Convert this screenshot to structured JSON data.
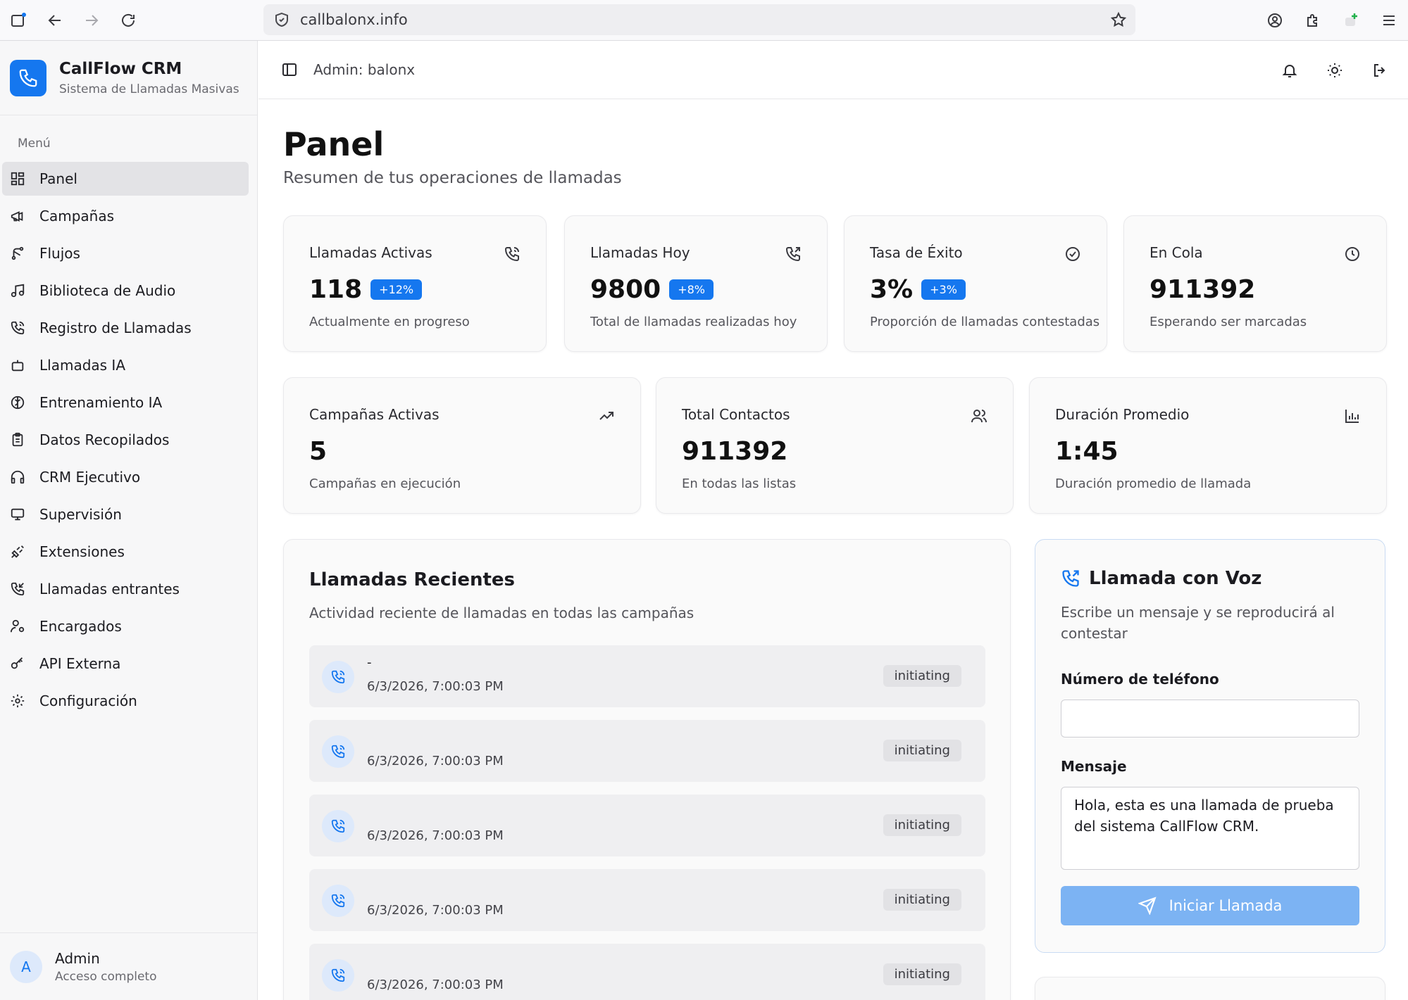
{
  "browser": {
    "url": "callbalonx.info"
  },
  "brand": {
    "title": "CallFlow CRM",
    "subtitle": "Sistema de Llamadas Masivas",
    "accent_color": "#1577ef"
  },
  "sidebar": {
    "menu_label": "Menú",
    "items": [
      {
        "label": "Panel",
        "icon": "grid-icon",
        "active": true
      },
      {
        "label": "Campañas",
        "icon": "megaphone-icon"
      },
      {
        "label": "Flujos",
        "icon": "workflow-icon"
      },
      {
        "label": "Biblioteca de Audio",
        "icon": "music-icon"
      },
      {
        "label": "Registro de Llamadas",
        "icon": "phone-icon"
      },
      {
        "label": "Llamadas IA",
        "icon": "bot-icon"
      },
      {
        "label": "Entrenamiento IA",
        "icon": "brain-icon"
      },
      {
        "label": "Datos Recopilados",
        "icon": "clipboard-icon"
      },
      {
        "label": "CRM Ejecutivo",
        "icon": "headphones-icon"
      },
      {
        "label": "Supervisión",
        "icon": "monitor-icon"
      },
      {
        "label": "Extensiones",
        "icon": "plug-icon"
      },
      {
        "label": "Llamadas entrantes",
        "icon": "phone-incoming-icon"
      },
      {
        "label": "Encargados",
        "icon": "user-cog-icon"
      },
      {
        "label": "API Externa",
        "icon": "key-icon"
      },
      {
        "label": "Configuración",
        "icon": "settings-icon"
      }
    ],
    "user": {
      "initial": "A",
      "name": "Admin",
      "role": "Acceso completo"
    }
  },
  "header": {
    "admin_label": "Admin: balonx"
  },
  "page": {
    "title": "Panel",
    "subtitle": "Resumen de tus operaciones de llamadas"
  },
  "stats_row1": [
    {
      "label": "Llamadas Activas",
      "value": "118",
      "badge": "+12%",
      "desc": "Actualmente en progreso",
      "icon": "phone-call-icon"
    },
    {
      "label": "Llamadas Hoy",
      "value": "9800",
      "badge": "+8%",
      "desc": "Total de llamadas realizadas hoy",
      "icon": "phone-outgoing-icon"
    },
    {
      "label": "Tasa de Éxito",
      "value": "3%",
      "badge": "+3%",
      "desc": "Proporción de llamadas contestadas",
      "icon": "check-circle-icon"
    },
    {
      "label": "En Cola",
      "value": "911392",
      "badge": "",
      "desc": "Esperando ser marcadas",
      "icon": "clock-icon"
    }
  ],
  "stats_row2": [
    {
      "label": "Campañas Activas",
      "value": "5",
      "desc": "Campañas en ejecución",
      "icon": "trending-up-icon"
    },
    {
      "label": "Total Contactos",
      "value": "911392",
      "desc": "En todas las listas",
      "icon": "users-icon"
    },
    {
      "label": "Duración Promedio",
      "value": "1:45",
      "desc": "Duración promedio de llamada",
      "icon": "bar-chart-icon"
    }
  ],
  "recent_calls": {
    "title": "Llamadas Recientes",
    "subtitle": "Actividad reciente de llamadas en todas las campañas",
    "items": [
      {
        "name": "-",
        "time": "6/3/2026, 7:00:03 PM",
        "status": "initiating"
      },
      {
        "name": "",
        "time": "6/3/2026, 7:00:03 PM",
        "status": "initiating"
      },
      {
        "name": "",
        "time": "6/3/2026, 7:00:03 PM",
        "status": "initiating"
      },
      {
        "name": "",
        "time": "6/3/2026, 7:00:03 PM",
        "status": "initiating"
      },
      {
        "name": "",
        "time": "6/3/2026, 7:00:03 PM",
        "status": "initiating"
      }
    ]
  },
  "voice_call": {
    "title": "Llamada con Voz",
    "subtitle": "Escribe un mensaje y se reproducirá al contestar",
    "phone_label": "Número de teléfono",
    "phone_value": "",
    "message_label": "Mensaje",
    "message_value": "Hola, esta es una llamada de prueba del sistema CallFlow CRM.",
    "button_label": "Iniciar Llamada"
  }
}
